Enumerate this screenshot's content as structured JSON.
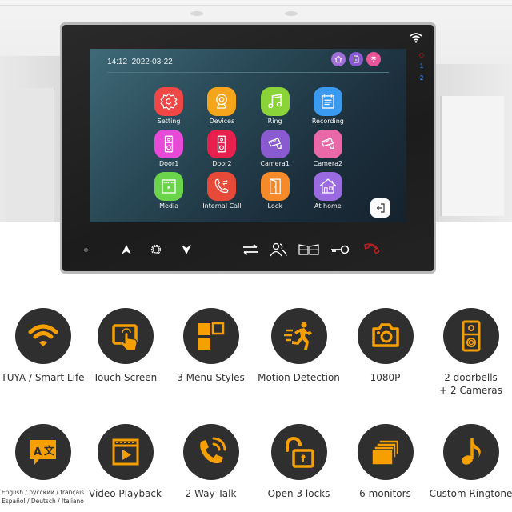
{
  "screen": {
    "time": "14:12",
    "date": "2022-03-22",
    "status_icons": [
      {
        "name": "home-mode-icon",
        "color": "#a06fd8"
      },
      {
        "name": "sd-card-icon",
        "color": "#8a5ad0"
      },
      {
        "name": "wifi-status-icon",
        "color": "#e8559a"
      }
    ],
    "apps": [
      {
        "label": "Setting",
        "icon": "gear-icon",
        "color": "#f04646"
      },
      {
        "label": "Devices",
        "icon": "webcam-icon",
        "color": "#f5a51c"
      },
      {
        "label": "Ring",
        "icon": "music-note-icon",
        "color": "#8ad43a"
      },
      {
        "label": "Recording",
        "icon": "notepad-icon",
        "color": "#3a9af0"
      },
      {
        "label": "Door1",
        "icon": "doorbell-icon",
        "color": "#e84ad8"
      },
      {
        "label": "Door2",
        "icon": "doorbell-icon",
        "color": "#e8204e"
      },
      {
        "label": "Camera1",
        "icon": "cctv-camera-icon",
        "color": "#8a5ad0"
      },
      {
        "label": "Camera2",
        "icon": "cctv-camera-icon",
        "color": "#e868a8"
      },
      {
        "label": "Media",
        "icon": "video-player-icon",
        "color": "#6ad44a"
      },
      {
        "label": "Internal Call",
        "icon": "phone-transfer-icon",
        "color": "#e84a3a"
      },
      {
        "label": "Lock",
        "icon": "door-icon",
        "color": "#f58a2a"
      },
      {
        "label": "At home",
        "icon": "house-icon",
        "color": "#9a6ae0"
      }
    ],
    "back_button": "exit-icon"
  },
  "frame": {
    "indicators": [
      "1",
      "2"
    ],
    "power_color": "#8a1a1a",
    "indicator_color": "#2a6fd8",
    "hardware_buttons": [
      {
        "name": "up-button",
        "icon": "arrow-up-icon"
      },
      {
        "name": "settings-button",
        "icon": "gear-icon"
      },
      {
        "name": "down-button",
        "icon": "arrow-down-icon"
      },
      {
        "name": "transfer-button",
        "icon": "transfer-arrows-icon"
      },
      {
        "name": "intercom-button",
        "icon": "users-icon"
      },
      {
        "name": "gate-button",
        "icon": "gate-icon"
      },
      {
        "name": "unlock-button",
        "icon": "key-icon"
      },
      {
        "name": "hangup-button",
        "icon": "hangup-phone-icon",
        "color": "#c81e1e"
      }
    ]
  },
  "features": {
    "accent": "#f5a000",
    "circle_color": "#2f2f2f",
    "items": [
      {
        "label": "TUYA / Smart Life",
        "icon": "wifi-icon"
      },
      {
        "label": "Touch Screen",
        "icon": "touch-screen-icon"
      },
      {
        "label": "3 Menu Styles",
        "icon": "menu-styles-icon"
      },
      {
        "label": "Motion Detection",
        "icon": "running-person-icon"
      },
      {
        "label": "1080P",
        "icon": "camera-icon"
      },
      {
        "label": "2 doorbells",
        "label2": "+ 2 Cameras",
        "icon": "doorbell-icon"
      },
      {
        "label": "English / русский / français",
        "label2": "Español /  Deutsch / Italiano",
        "icon": "translate-icon"
      },
      {
        "label": "Video Playback",
        "icon": "video-playback-icon"
      },
      {
        "label": "2 Way Talk",
        "icon": "phone-call-icon"
      },
      {
        "label": "Open 3 locks",
        "icon": "unlock-icon"
      },
      {
        "label": "6 monitors",
        "icon": "monitors-icon"
      },
      {
        "label": "Custom Ringtone",
        "icon": "music-note-icon"
      }
    ]
  }
}
